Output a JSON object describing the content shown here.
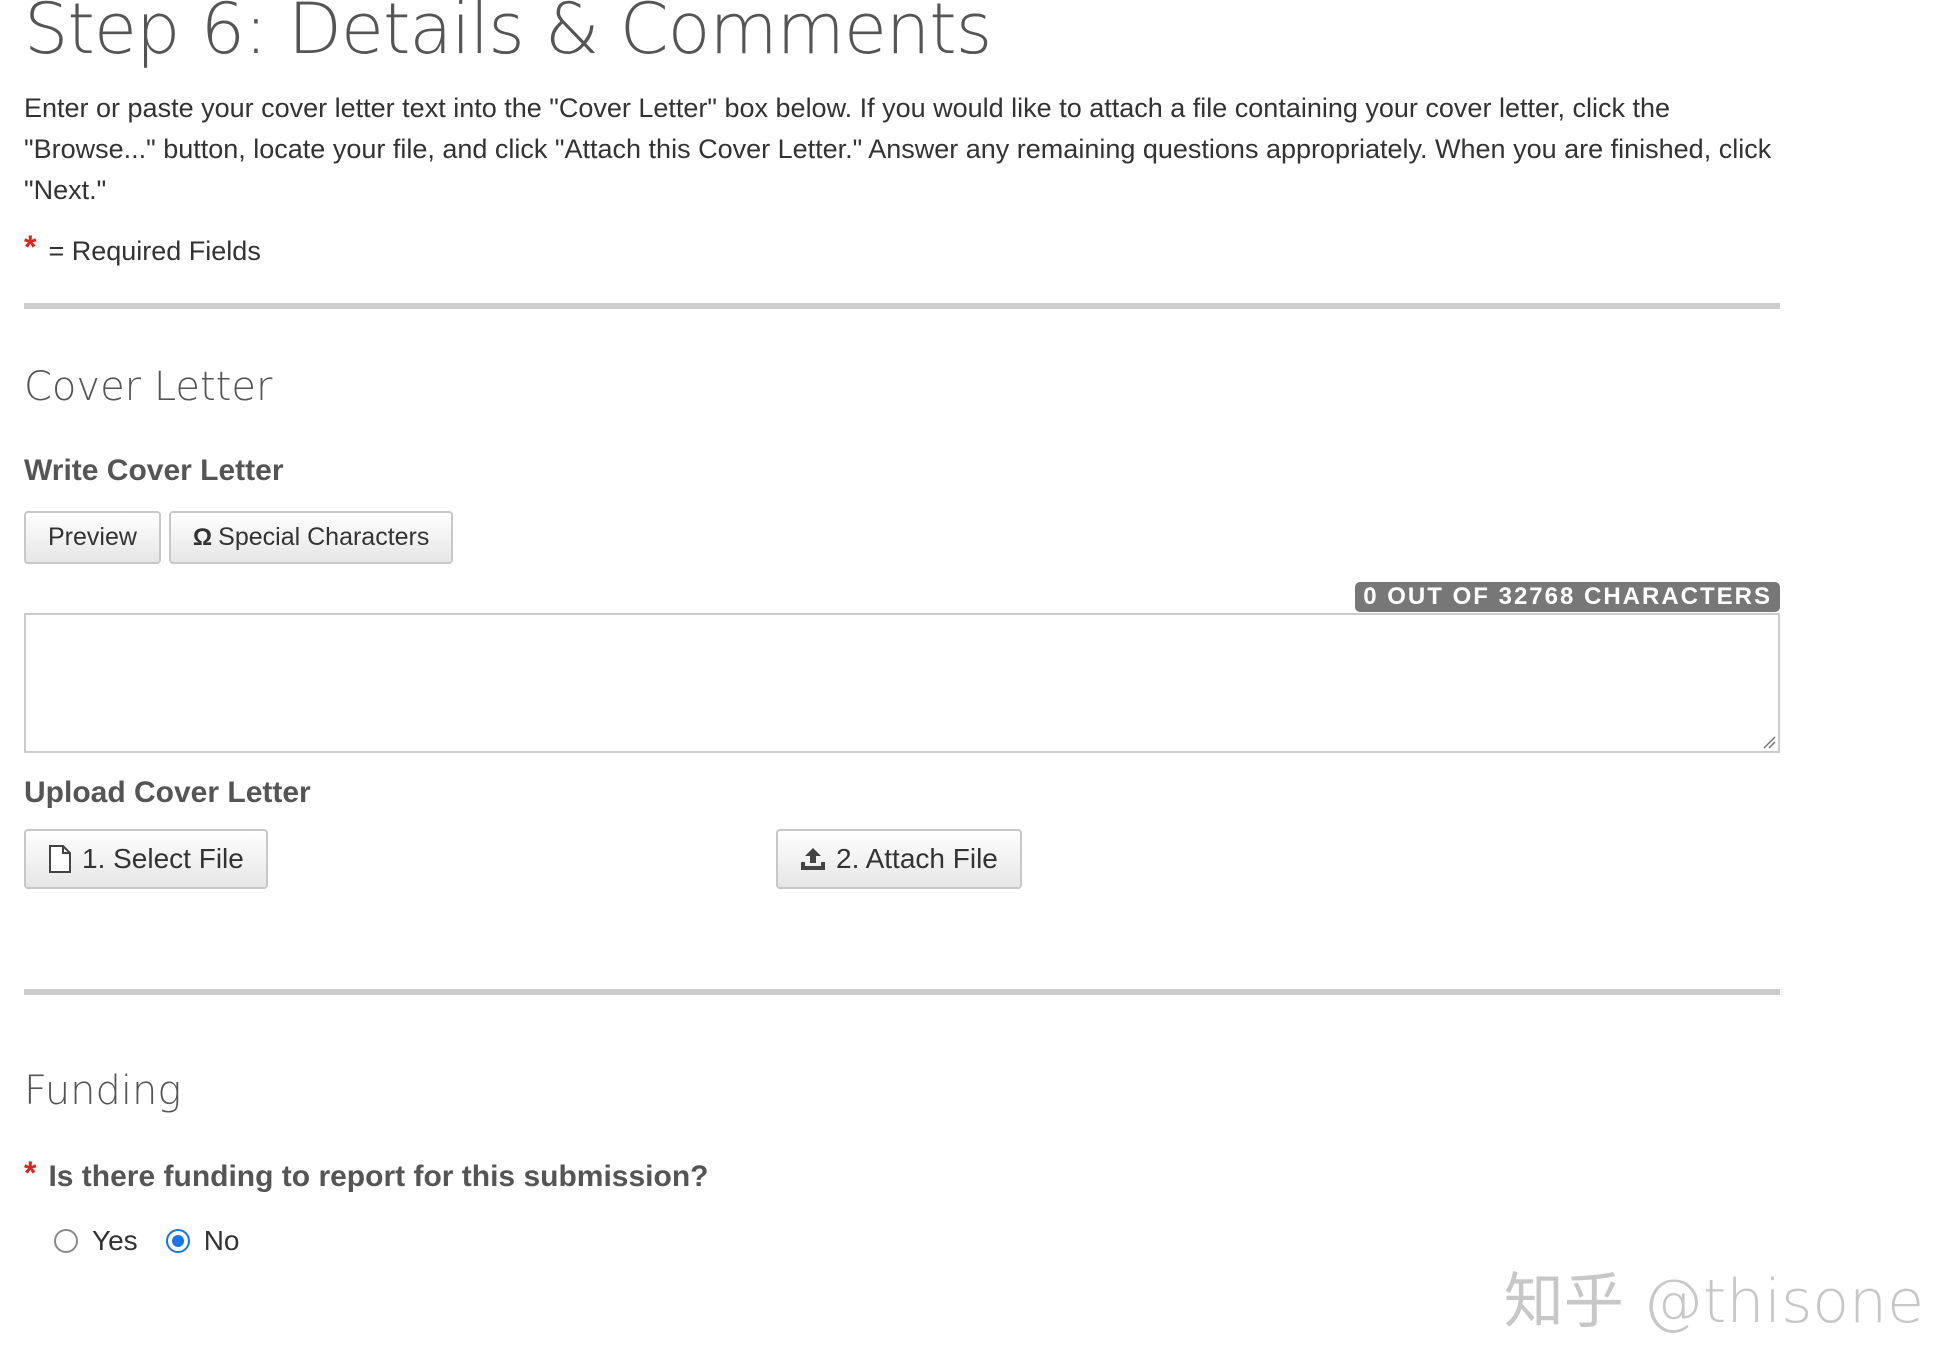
{
  "header": {
    "title": "Step 6: Details & Comments",
    "intro": "Enter or paste your cover letter text into the \"Cover Letter\" box below. If you would like to attach a file containing your cover letter, click the \"Browse...\" button, locate your file, and click \"Attach this Cover Letter.\" Answer any remaining questions appropriately. When you are finished, click \"Next.\"",
    "required_marker": "*",
    "required_legend": "= Required Fields"
  },
  "cover_letter": {
    "section_title": "Cover Letter",
    "write_title": "Write Cover Letter",
    "preview_label": "Preview",
    "special_chars_icon": "omega-icon",
    "special_chars_symbol": "Ω",
    "special_chars_label": "Special Characters",
    "counter": "0 OUT OF 32768 CHARACTERS",
    "textarea_value": "",
    "upload_title": "Upload Cover Letter",
    "select_file_icon": "file-icon",
    "select_file_label": "1. Select File",
    "attach_file_icon": "upload-icon",
    "attach_file_label": "2. Attach File"
  },
  "funding": {
    "section_title": "Funding",
    "required_marker": "*",
    "question": "Is there funding to report for this submission?",
    "options": [
      {
        "label": "Yes",
        "checked": false
      },
      {
        "label": "No",
        "checked": true
      }
    ]
  },
  "watermark": "知乎 @thisone",
  "colors": {
    "required": "#d9261c",
    "radio_selected": "#1a73e8",
    "divider": "#cccccc",
    "counter_bg": "#777777"
  }
}
